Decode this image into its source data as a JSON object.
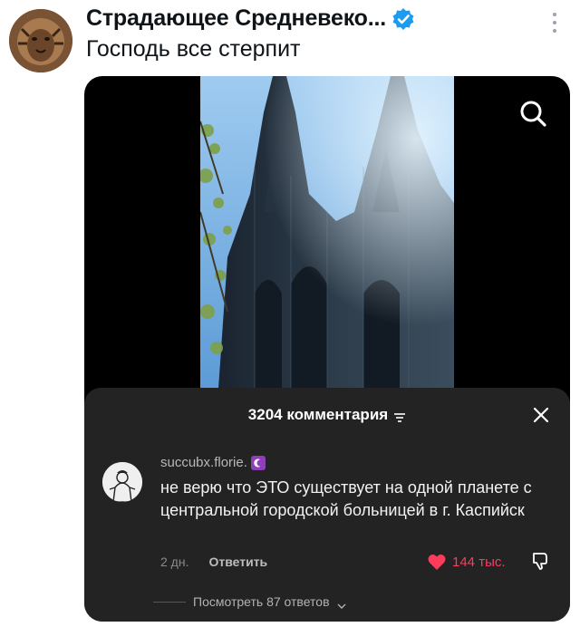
{
  "post": {
    "author_name": "Страдающее Средневеко...",
    "text": "Господь все стерпит"
  },
  "comments": {
    "count_title": "3204 комментария",
    "comment": {
      "username": "succubx.florie.",
      "body": "не верю что ЭТО существует на одной планете с центральной городской больницей в г. Каспийск",
      "date": "2 дн.",
      "reply_label": "Ответить",
      "likes": "144 тыс."
    },
    "view_replies": "Посмотреть 87 ответов"
  },
  "colors": {
    "verified": "#1d9bf0",
    "like": "#ff3b5c",
    "sheet_bg": "#232323"
  },
  "icons": [
    "more-vertical-icon",
    "verified-icon",
    "search-icon",
    "filter-icon",
    "close-icon",
    "moon-icon",
    "heart-icon",
    "dislike-icon",
    "chevron-down-icon"
  ]
}
